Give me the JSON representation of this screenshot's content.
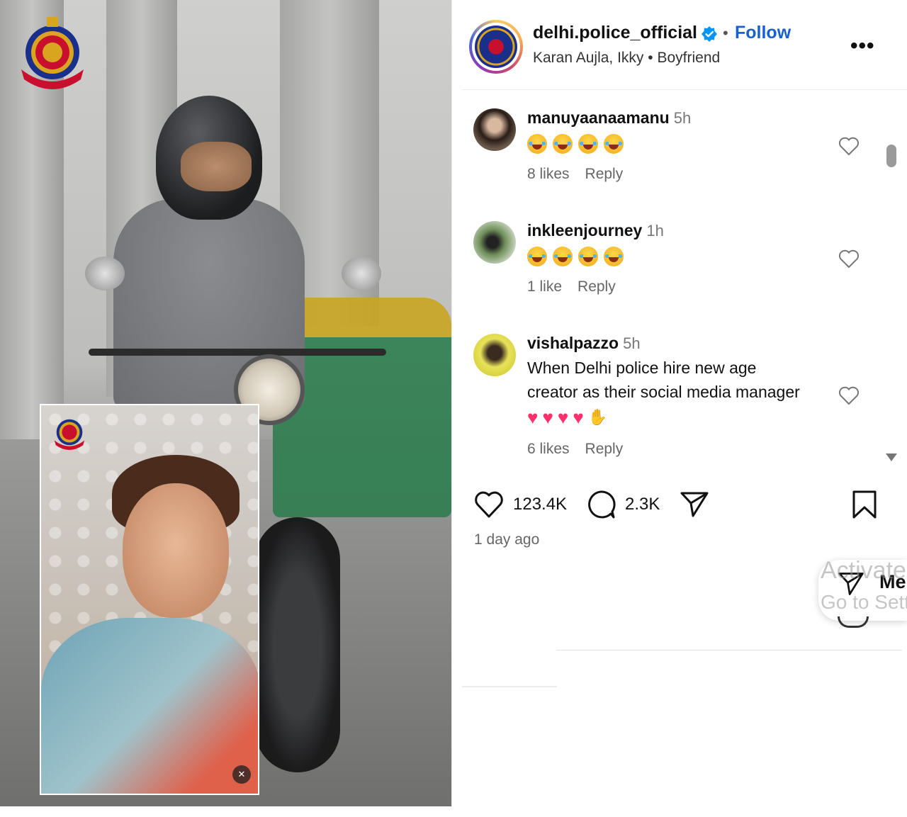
{
  "post": {
    "account": "delhi.police_official",
    "follow_label": "Follow",
    "audio_artist": "Karan Aujla, Ikky",
    "audio_separator": "•",
    "audio_track": "Boyfriend",
    "more_label": "•••"
  },
  "comments": [
    {
      "user": "manuyaanaamanu",
      "time": "5h",
      "emoji_count": 4,
      "likes": "8 likes",
      "reply": "Reply"
    },
    {
      "user": "inkleenjourney",
      "time": "1h",
      "emoji_count": 4,
      "likes": "1 like",
      "reply": "Reply"
    },
    {
      "user": "vishalpazzo",
      "time": "5h",
      "text": "When Delhi police hire new age creator as their social media manager",
      "likes": "6 likes",
      "reply": "Reply"
    }
  ],
  "actions": {
    "likes_count": "123.4K",
    "comments_count": "2.3K",
    "posted": "1 day ago"
  },
  "overlay": {
    "messages_label": "Me",
    "watermark_line1": "Activate",
    "watermark_line2": "Go to Sett"
  },
  "colors": {
    "follow_blue": "#1a5fd0",
    "verified_blue": "#0095f6",
    "heart_pink": "#ff2f6b"
  }
}
